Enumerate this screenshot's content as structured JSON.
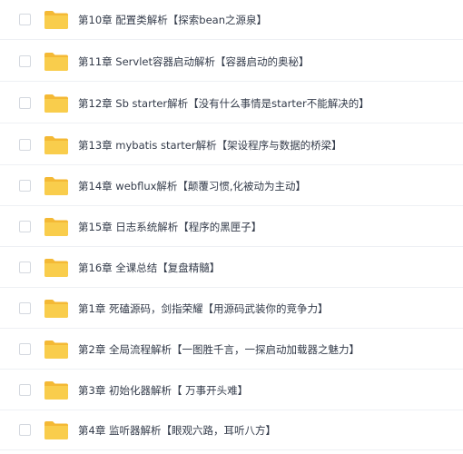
{
  "folder_color": "#f9cd4c",
  "folder_tab_color": "#f4b935",
  "items": [
    {
      "name": "第10章 配置类解析【探索bean之源泉】",
      "icon": "folder-icon"
    },
    {
      "name": "第11章 Servlet容器启动解析【容器启动的奥秘】",
      "icon": "folder-icon"
    },
    {
      "name": "第12章 Sb starter解析【没有什么事情是starter不能解决的】",
      "icon": "folder-icon"
    },
    {
      "name": "第13章 mybatis starter解析【架设程序与数据的桥梁】",
      "icon": "folder-icon"
    },
    {
      "name": "第14章 webflux解析【颠覆习惯,化被动为主动】",
      "icon": "folder-icon"
    },
    {
      "name": "第15章 日志系统解析【程序的黑匣子】",
      "icon": "folder-icon"
    },
    {
      "name": "第16章 全课总结【复盘精髓】",
      "icon": "folder-icon"
    },
    {
      "name": "第1章 死磕源码，剑指荣耀【用源码武装你的竞争力】",
      "icon": "folder-icon"
    },
    {
      "name": "第2章 全局流程解析【一图胜千言，一探启动加载器之魅力】",
      "icon": "folder-icon"
    },
    {
      "name": "第3章 初始化器解析【 万事开头难】",
      "icon": "folder-icon"
    },
    {
      "name": "第4章 监听器解析【眼观六路，耳听八方】",
      "icon": "folder-icon"
    }
  ]
}
